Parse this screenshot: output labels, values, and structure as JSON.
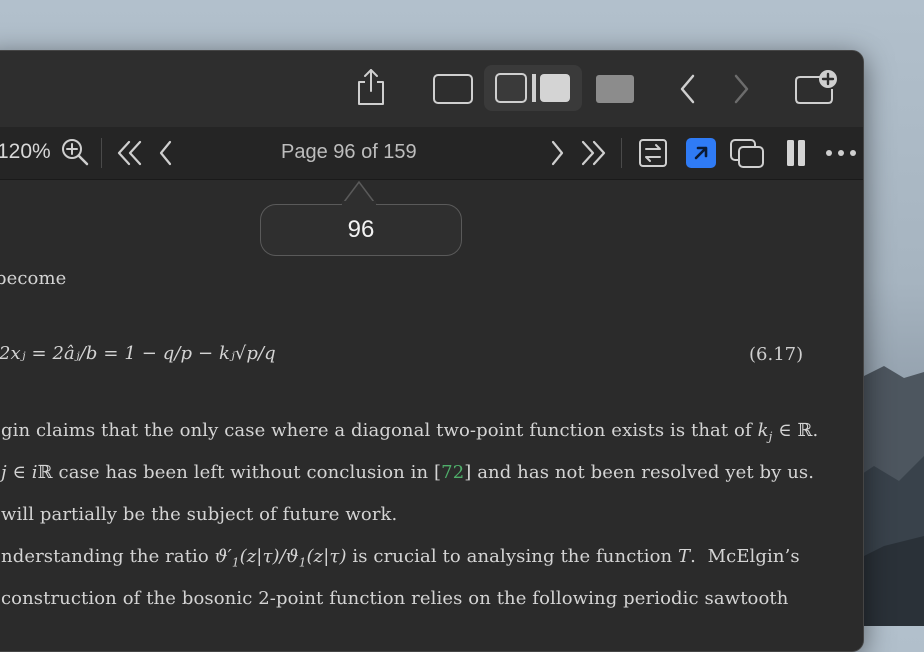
{
  "toolbar": {
    "zoom_label": "120%",
    "page_label": "Page 96 of 159"
  },
  "popup": {
    "page_number": "96"
  },
  "document": {
    "lines": [
      "become",
      "2x",
      "gin claims that the only case where a diagonal two-point function exists is that of ",
      "case has been left without conclusion in [",
      "72",
      "] and has not been resolved yet by us.",
      "will partially be the subject of future work.",
      "nderstanding the ratio ",
      " is crucial to analysing the function ",
      "McElgin’s",
      "construction of the bosonic 2-point function relies on the following periodic sawtooth"
    ],
    "equation": {
      "text": "2xⱼ = 2âⱼ/b = 1 − q/p − kⱼ√p/q",
      "number": "(6.17)"
    }
  },
  "icons": {
    "share": "share-icon",
    "single_page": "single-page-icon",
    "two_page": "two-page-icon",
    "scroll": "continuous-scroll-icon",
    "back": "chevron-left-icon",
    "forward": "chevron-right-icon",
    "new_tab": "new-tab-icon",
    "zoom_in": "zoom-in-icon",
    "first_page": "double-chevron-left-icon",
    "prev_page": "chevron-left-icon",
    "next_page": "chevron-right-icon",
    "last_page": "double-chevron-right-icon",
    "sync": "sync-icon",
    "link": "link-arrow-icon",
    "overlay": "overlay-windows-icon",
    "pause": "pause-icon",
    "more": "more-icon"
  },
  "colors": {
    "accent": "#2f7bf5",
    "link_green": "#4fae6a"
  }
}
